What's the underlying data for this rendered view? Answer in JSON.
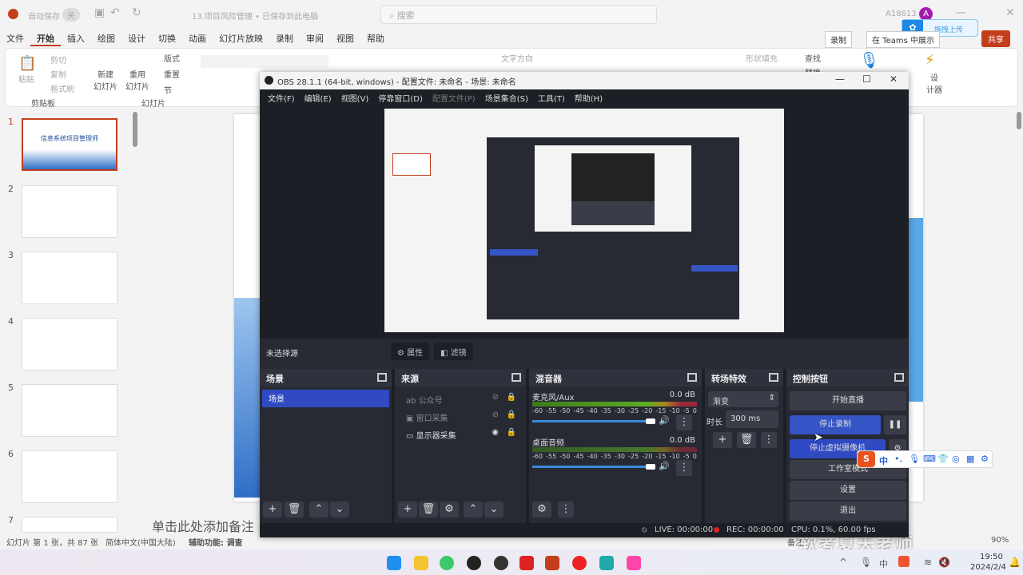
{
  "ppt": {
    "autosave": "自动保存",
    "autosave_state": "关",
    "doc_title": "13.项目风险管理 • 已保存到此电脑",
    "search_placeholder": "搜索",
    "user": "A18613",
    "avatar": "A",
    "upload": "拖拽上传",
    "tabs": [
      "文件",
      "开始",
      "插入",
      "绘图",
      "设计",
      "切换",
      "动画",
      "幻灯片放映",
      "录制",
      "审阅",
      "视图",
      "帮助"
    ],
    "record_btn": "录制",
    "teams_btn": "在 Teams 中展示",
    "share_btn": "共享",
    "ribbon": {
      "paste": "粘贴",
      "cut": "剪切",
      "copy": "复制",
      "format_painter": "格式刷",
      "clipboard": "剪贴板",
      "new_slide": "新建\n幻灯片",
      "reuse_slide": "重用\n幻灯片",
      "layout": "版式",
      "reset": "重置",
      "section": "节",
      "slides_group": "幻灯片",
      "text_direction": "文字方向",
      "shape_fill": "形状填充",
      "find": "查找",
      "replace": "替换",
      "designer": "设\n计器"
    },
    "thumb_numbers": [
      "1",
      "2",
      "3",
      "4",
      "5",
      "6",
      "7"
    ],
    "slide1_title": "信息系统项目管理师",
    "notes_placeholder": "单击此处添加备注",
    "status": {
      "slide_count": "幻灯片 第 1 张，共 87 张",
      "language": "简体中文(中国大陆)",
      "accessibility": "辅助功能: 调查",
      "notes": "备注",
      "zoom": "90%"
    },
    "watermark": "软考夏天老师"
  },
  "obs": {
    "title": "OBS 28.1.1 (64-bit, windows) - 配置文件: 未命名 - 场景: 未命名",
    "menu": [
      "文件(F)",
      "编辑(E)",
      "视图(V)",
      "停靠窗口(D)",
      "配置文件(P)",
      "场景集合(S)",
      "工具(T)",
      "帮助(H)"
    ],
    "no_source": "未选择源",
    "properties": "属性",
    "filters": "滤镜",
    "scenes": {
      "title": "场景",
      "items": [
        "场景"
      ]
    },
    "sources": {
      "title": "来源",
      "items": [
        "公众号",
        "窗口采集",
        "显示器采集"
      ]
    },
    "mixer": {
      "title": "混音器",
      "channels": [
        {
          "name": "麦克风/Aux",
          "db": "0.0 dB"
        },
        {
          "name": "桌面音频",
          "db": "0.0 dB"
        }
      ],
      "scale": [
        "-60",
        "-55",
        "-50",
        "-45",
        "-40",
        "-35",
        "-30",
        "-25",
        "-20",
        "-15",
        "-10",
        "-5",
        "0"
      ]
    },
    "transitions": {
      "title": "转场特效",
      "type": "渐变",
      "duration_label": "时长",
      "duration": "300 ms"
    },
    "controls": {
      "title": "控制按钮",
      "start_stream": "开始直播",
      "stop_record": "停止录制",
      "stop_vcam": "停止虚拟摄像机",
      "studio": "工作室模式",
      "settings": "设置",
      "exit": "退出"
    },
    "status": {
      "live": "LIVE: 00:00:00",
      "rec": "REC: 00:00:00",
      "cpu": "CPU: 0.1%, 60.00 fps"
    }
  },
  "ime": {
    "mode": "中"
  },
  "taskbar": {
    "ime": "中",
    "time": "19:50",
    "date": "2024/2/4"
  }
}
